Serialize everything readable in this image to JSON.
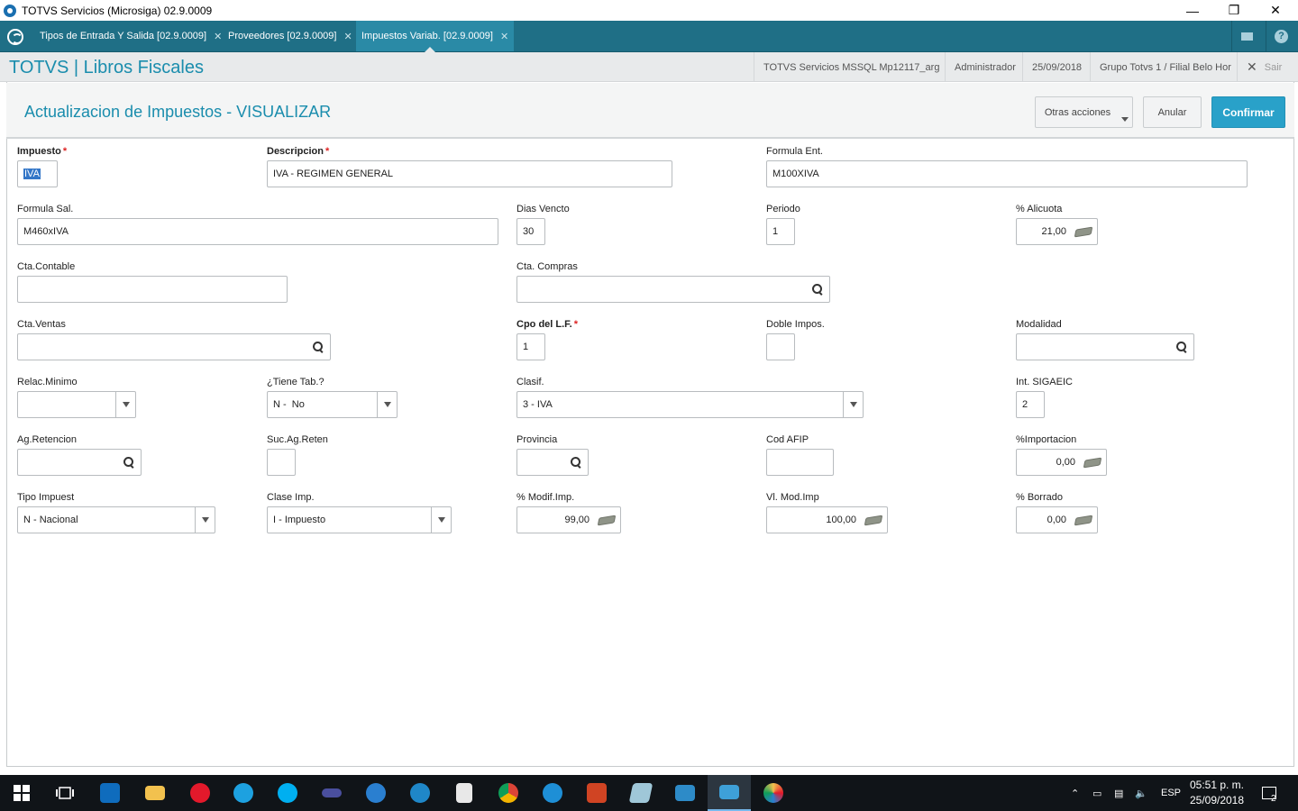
{
  "window": {
    "title": "TOTVS Servicios (Microsiga) 02.9.0009"
  },
  "tabs": [
    {
      "label": "Tipos de Entrada Y Salida [02.9.0009]"
    },
    {
      "label": "Proveedores [02.9.0009]"
    },
    {
      "label": "Impuestos Variab. [02.9.0009]"
    }
  ],
  "header": {
    "brand": "TOTVS | Libros Fiscales",
    "server": "TOTVS Servicios MSSQL Mp12117_arg",
    "user": "Administrador",
    "date": "25/09/2018",
    "branch": "Grupo Totvs 1 / Filial Belo Hor",
    "exit": "Sair"
  },
  "page": {
    "title": "Actualizacion de Impuestos - VISUALIZAR",
    "other_actions": "Otras acciones",
    "cancel": "Anular",
    "confirm": "Confirmar"
  },
  "form": {
    "impuesto": {
      "label": "Impuesto",
      "value": "IVA"
    },
    "descripcion": {
      "label": "Descripcion",
      "value": "IVA - REGIMEN GENERAL"
    },
    "formula_ent": {
      "label": "Formula Ent.",
      "value": "M100XIVA"
    },
    "formula_sal": {
      "label": "Formula Sal.",
      "value": "M460xIVA"
    },
    "dias_vencto": {
      "label": "Dias Vencto",
      "value": "30"
    },
    "periodo": {
      "label": "Periodo",
      "value": "1"
    },
    "alicuota": {
      "label": "% Alicuota",
      "value": "21,00"
    },
    "cta_contable": {
      "label": "Cta.Contable",
      "value": ""
    },
    "cta_compras": {
      "label": "Cta. Compras",
      "value": ""
    },
    "cta_ventas": {
      "label": "Cta.Ventas",
      "value": ""
    },
    "cpo_lf": {
      "label": "Cpo del L.F.",
      "value": "1"
    },
    "doble_impos": {
      "label": "Doble Impos.",
      "value": ""
    },
    "modalidad": {
      "label": "Modalidad",
      "value": ""
    },
    "relac_minimo": {
      "label": "Relac.Minimo",
      "value": ""
    },
    "tiene_tab": {
      "label": "¿Tiene Tab.?",
      "value": "N -  No"
    },
    "clasif": {
      "label": "Clasif.",
      "value": "3 - IVA"
    },
    "int_sigaeic": {
      "label": "Int. SIGAEIC",
      "value": "2"
    },
    "ag_retencion": {
      "label": "Ag.Retencion",
      "value": ""
    },
    "suc_ag_reten": {
      "label": "Suc.Ag.Reten",
      "value": ""
    },
    "provincia": {
      "label": "Provincia",
      "value": ""
    },
    "cod_afip": {
      "label": "Cod AFIP",
      "value": ""
    },
    "importacion": {
      "label": "%Importacion",
      "value": "0,00"
    },
    "tipo_impuest": {
      "label": "Tipo Impuest",
      "value": "N - Nacional"
    },
    "clase_imp": {
      "label": "Clase Imp.",
      "value": "I - Impuesto"
    },
    "modif_imp": {
      "label": "% Modif.Imp.",
      "value": "99,00"
    },
    "vl_mod_imp": {
      "label": "Vl. Mod.Imp",
      "value": "100,00"
    },
    "borrado": {
      "label": "% Borrado",
      "value": "0,00"
    }
  },
  "taskbar": {
    "lang": "ESP",
    "time": "05:51 p. m.",
    "date": "25/09/2018",
    "notifications": "2"
  }
}
